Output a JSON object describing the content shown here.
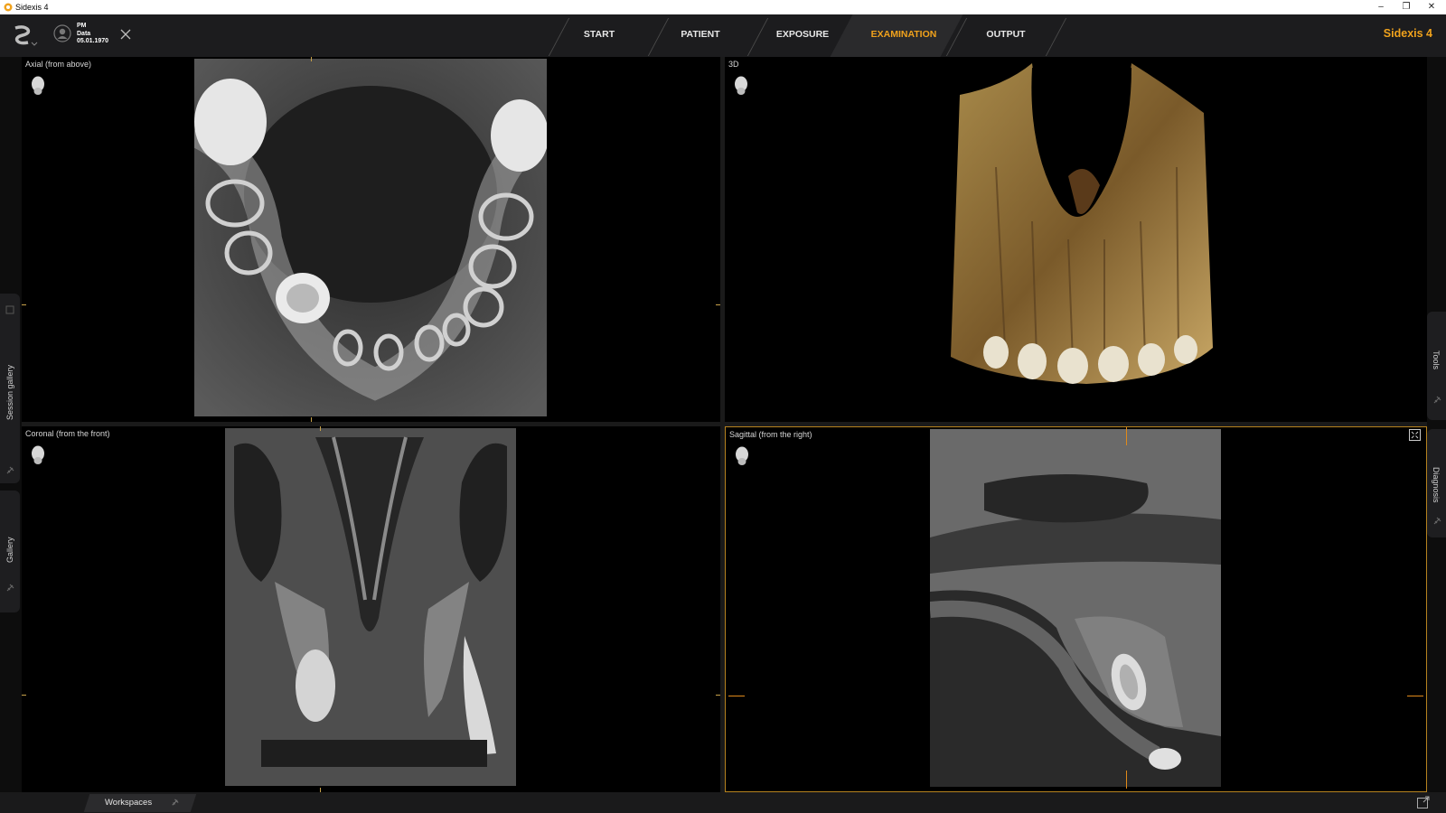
{
  "window": {
    "title": "Sidexis 4"
  },
  "patient": {
    "initials": "PM",
    "name": "Data",
    "dob": "05.01.1970"
  },
  "tabs": [
    {
      "label": "START",
      "active": false
    },
    {
      "label": "PATIENT",
      "active": false
    },
    {
      "label": "EXPOSURE",
      "active": false
    },
    {
      "label": "EXAMINATION",
      "active": true
    },
    {
      "label": "OUTPUT",
      "active": false
    }
  ],
  "brand": "Sidexis 4",
  "left_rail": {
    "session_gallery": "Session gallery",
    "gallery": "Gallery"
  },
  "right_rail": {
    "tools": "Tools",
    "diagnosis": "Diagnosis"
  },
  "viewports": {
    "axial": {
      "label": "Axial (from above)"
    },
    "three_d": {
      "label": "3D"
    },
    "coronal": {
      "label": "Coronal (from the front)"
    },
    "sagittal": {
      "label": "Sagittal (from the right)"
    }
  },
  "bottom": {
    "workspaces": "Workspaces"
  },
  "colors": {
    "accent": "#f0a21c",
    "focus_border": "#b7831f",
    "header_bg": "#1c1c1e"
  }
}
